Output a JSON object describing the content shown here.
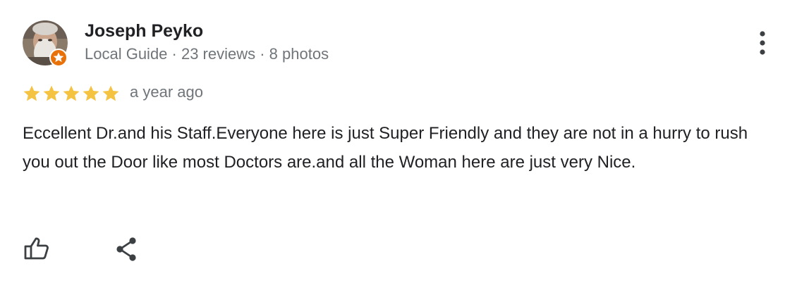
{
  "reviewer": {
    "name": "Joseph Peyko",
    "meta": "Local Guide · 23 reviews · 8 photos",
    "avatar_icon": "user-avatar",
    "badge_icon": "local-guide-star-badge",
    "badge_color": "#e8710a"
  },
  "review": {
    "rating": 5,
    "rating_max": 5,
    "star_color": "#f4c342",
    "date": "a year ago",
    "text": "Eccellent Dr.and his Staff.Everyone here is just Super Friendly and they are not in a hurry to rush you out the Door like most Doctors are.and all the Woman here are just very Nice."
  },
  "actions": {
    "more_icon": "more-vert-icon",
    "like_icon": "thumb-up-icon",
    "share_icon": "share-icon"
  }
}
